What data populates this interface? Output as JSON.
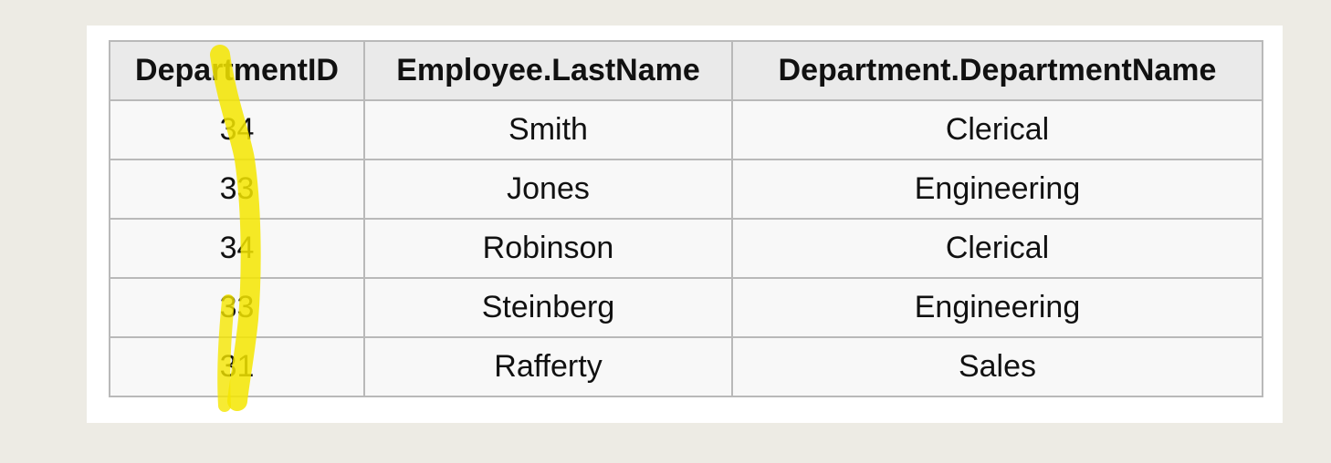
{
  "table": {
    "columns": [
      "DepartmentID",
      "Employee.LastName",
      "Department.DepartmentName"
    ],
    "rows": [
      [
        "34",
        "Smith",
        "Clerical"
      ],
      [
        "33",
        "Jones",
        "Engineering"
      ],
      [
        "34",
        "Robinson",
        "Clerical"
      ],
      [
        "33",
        "Steinberg",
        "Engineering"
      ],
      [
        "31",
        "Rafferty",
        "Sales"
      ]
    ]
  },
  "annotation": {
    "highlighter_color": "#f5e600"
  }
}
